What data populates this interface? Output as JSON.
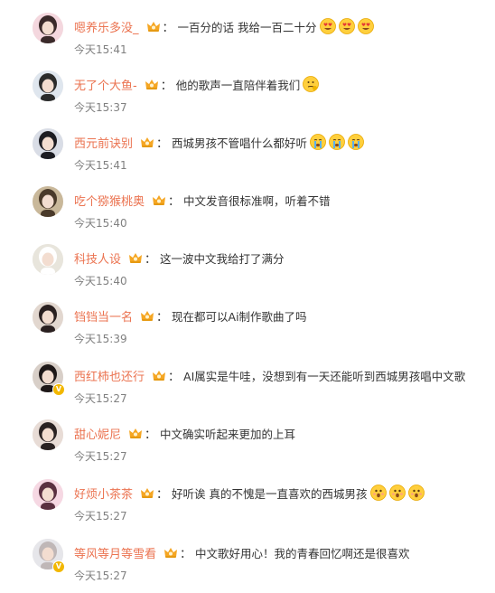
{
  "comments": [
    {
      "nick": "嗯养乐多没_",
      "text": "一百分的话 我给一百二十分",
      "time": "今天15:41",
      "emojis": [
        "heart-eyes",
        "heart-eyes",
        "heart-eyes"
      ],
      "verified": false
    },
    {
      "nick": "无了个大鱼-",
      "text": "他的歌声一直陪伴着我们",
      "time": "今天15:37",
      "emojis": [
        "thinking"
      ],
      "verified": false
    },
    {
      "nick": "西元前诀别",
      "text": "西城男孩不管唱什么都好听",
      "time": "今天15:41",
      "emojis": [
        "crying",
        "crying",
        "crying"
      ],
      "verified": false
    },
    {
      "nick": "吃个猕猴桃奥",
      "text": "中文发音很标准啊，听着不错",
      "time": "今天15:40",
      "emojis": [],
      "verified": false
    },
    {
      "nick": "科技人设",
      "text": "这一波中文我给打了满分",
      "time": "今天15:40",
      "emojis": [],
      "verified": false
    },
    {
      "nick": "铛铛当一名",
      "text": "现在都可以Ai制作歌曲了吗",
      "time": "今天15:39",
      "emojis": [],
      "verified": false
    },
    {
      "nick": "西红柿也还行",
      "text": "AI属实是牛哇，没想到有一天还能听到西城男孩唱中文歌",
      "time": "今天15:27",
      "emojis": [],
      "verified": true
    },
    {
      "nick": "甜心妮尼",
      "text": "中文确实听起来更加的上耳",
      "time": "今天15:27",
      "emojis": [],
      "verified": false
    },
    {
      "nick": "好烦小茶茶",
      "text": "好听诶 真的不愧是一直喜欢的西城男孩",
      "time": "今天15:27",
      "emojis": [
        "shocked",
        "shocked",
        "shocked"
      ],
      "verified": false
    },
    {
      "nick": "等风等月等雪看",
      "text": "中文歌好用心！我的青春回忆啊还是很喜欢",
      "time": "今天15:27",
      "emojis": [],
      "verified": true
    }
  ],
  "colors": {
    "nick": "#eb7350",
    "text": "#333333",
    "time": "#808080",
    "crown": "#f5a623",
    "verified": "#f2b700"
  },
  "icons": {
    "badge": "crown-badge-icon",
    "verified": "verified-v-icon"
  }
}
